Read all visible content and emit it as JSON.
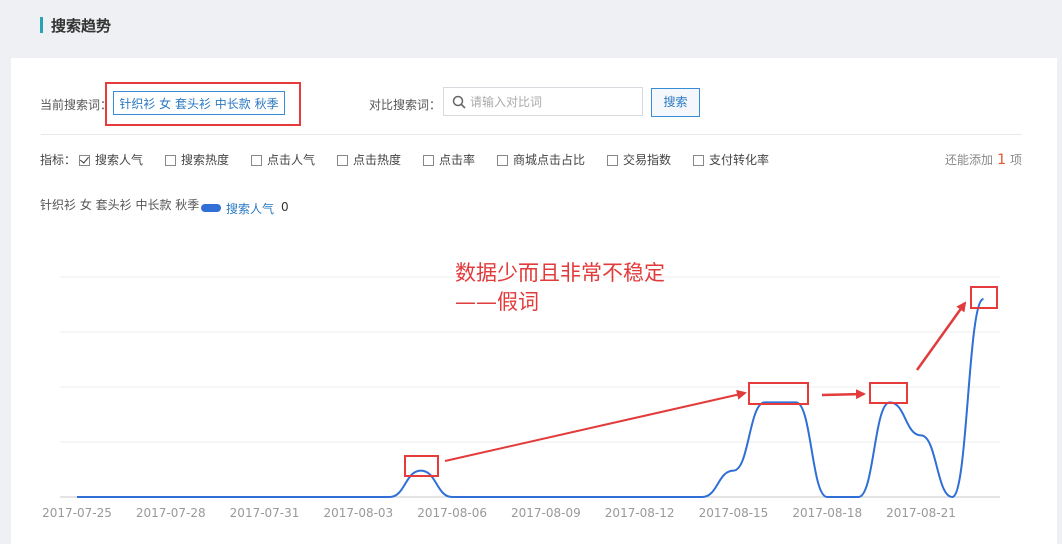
{
  "header": {
    "title": "搜索趋势"
  },
  "query": {
    "current_label": "当前搜索词：",
    "current_term": "针织衫 女 套头衫 中长款 秋季",
    "compare_label": "对比搜索词：",
    "compare_placeholder": "请输入对比词",
    "compare_value": "",
    "search_button": "搜索"
  },
  "metrics": {
    "label": "指标：",
    "items": [
      {
        "label": "搜索人气",
        "checked": true
      },
      {
        "label": "搜索热度",
        "checked": false
      },
      {
        "label": "点击人气",
        "checked": false
      },
      {
        "label": "点击热度",
        "checked": false
      },
      {
        "label": "点击率",
        "checked": false
      },
      {
        "label": "商城点击占比",
        "checked": false
      },
      {
        "label": "交易指数",
        "checked": false
      },
      {
        "label": "支付转化率",
        "checked": false
      }
    ],
    "remain_prefix": "还能添加",
    "remain_count": "1",
    "remain_suffix": "项"
  },
  "legend": {
    "term": "针织衫 女 套头衫 中长款 秋季",
    "metric": "搜索人气",
    "value": "0"
  },
  "annotation": {
    "line1": "数据少而且非常不稳定",
    "line2": "——假词"
  },
  "colors": {
    "line": "#2f6fd6",
    "annotation": "#e23b3b",
    "accent": "#29a3b4"
  },
  "chart_data": {
    "type": "line",
    "title": "",
    "xlabel": "",
    "ylabel": "",
    "grid": true,
    "x_tick_labels": [
      "2017-07-25",
      "2017-07-28",
      "2017-07-31",
      "2017-08-03",
      "2017-08-06",
      "2017-08-09",
      "2017-08-12",
      "2017-08-15",
      "2017-08-18",
      "2017-08-21"
    ],
    "x": [
      "2017-07-25",
      "2017-07-26",
      "2017-07-27",
      "2017-07-28",
      "2017-07-29",
      "2017-07-30",
      "2017-07-31",
      "2017-08-01",
      "2017-08-02",
      "2017-08-03",
      "2017-08-04",
      "2017-08-05",
      "2017-08-06",
      "2017-08-07",
      "2017-08-08",
      "2017-08-09",
      "2017-08-10",
      "2017-08-11",
      "2017-08-12",
      "2017-08-13",
      "2017-08-14",
      "2017-08-15",
      "2017-08-16",
      "2017-08-17",
      "2017-08-18",
      "2017-08-19",
      "2017-08-20",
      "2017-08-21",
      "2017-08-22",
      "2017-08-23"
    ],
    "series": [
      {
        "name": "搜索人气",
        "values": [
          0,
          0,
          0,
          0,
          0,
          0,
          0,
          0,
          0,
          0,
          0,
          0.12,
          0,
          0,
          0,
          0,
          0,
          0,
          0,
          0,
          0,
          0.12,
          0.43,
          0.43,
          0,
          0,
          0.43,
          0.28,
          0,
          0.9
        ]
      }
    ],
    "ylim": [
      0,
      1
    ]
  }
}
